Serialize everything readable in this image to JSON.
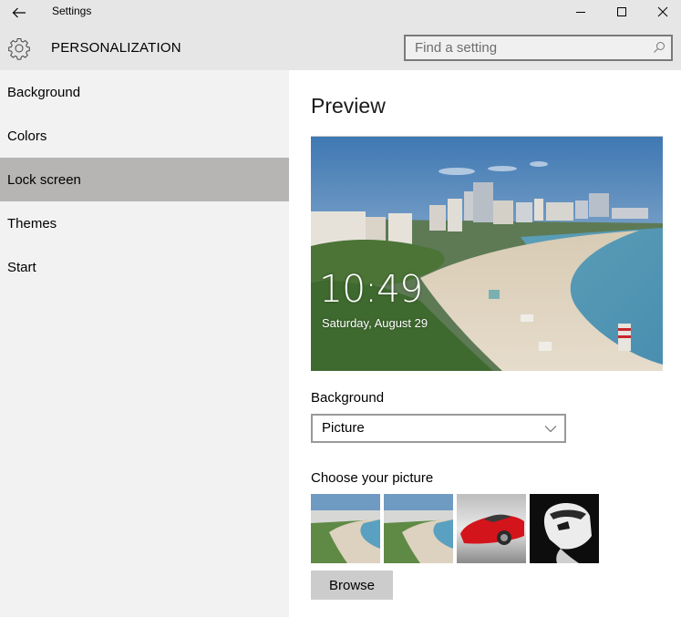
{
  "window": {
    "title": "Settings",
    "controls": {
      "minimize": "minimize",
      "maximize": "maximize",
      "close": "close"
    }
  },
  "header": {
    "section_title": "PERSONALIZATION",
    "search": {
      "value": "",
      "placeholder": "Find a setting"
    }
  },
  "sidebar": {
    "items": [
      {
        "label": "Background",
        "active": false
      },
      {
        "label": "Colors",
        "active": false
      },
      {
        "label": "Lock screen",
        "active": true
      },
      {
        "label": "Themes",
        "active": false
      },
      {
        "label": "Start",
        "active": false
      }
    ]
  },
  "main": {
    "preview_title": "Preview",
    "lock_screen": {
      "time": "10:49",
      "date": "Saturday, August 29"
    },
    "background_label": "Background",
    "background_select": {
      "value": "Picture"
    },
    "choose_label": "Choose your picture",
    "pictures": [
      {
        "subject": "beach-city"
      },
      {
        "subject": "beach-city"
      },
      {
        "subject": "red-sports-car"
      },
      {
        "subject": "stormtrooper"
      }
    ],
    "browse_label": "Browse"
  },
  "colors": {
    "titlebar_bg": "#e6e6e6",
    "sidebar_bg": "#f2f2f2",
    "sidebar_active": "#b6b5b3",
    "button_bg": "#cccccc"
  }
}
